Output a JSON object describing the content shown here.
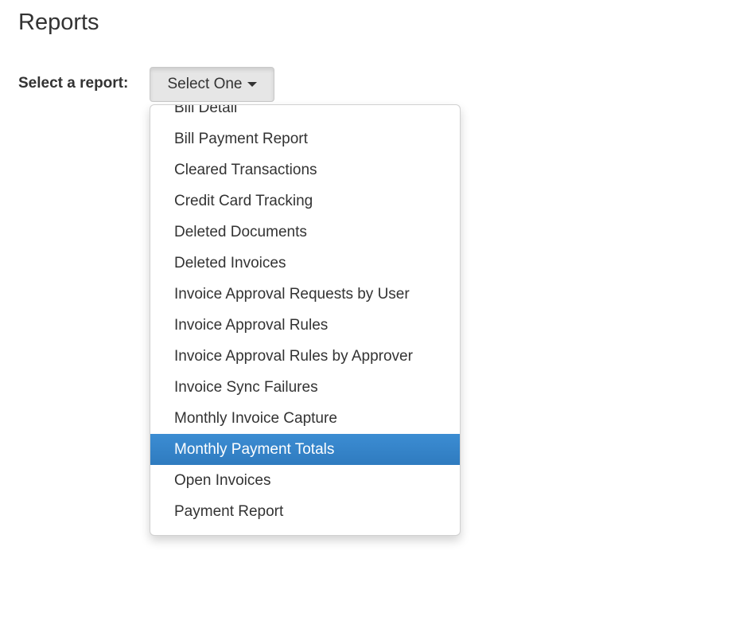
{
  "page": {
    "title": "Reports"
  },
  "report_selector": {
    "label": "Select a report:",
    "button_label": "Select One",
    "caret_icon": "caret-down-icon",
    "active_color": "#337ab7",
    "options": [
      {
        "label": "Bill Detail",
        "active": false
      },
      {
        "label": "Bill Payment Report",
        "active": false
      },
      {
        "label": "Cleared Transactions",
        "active": false
      },
      {
        "label": "Credit Card Tracking",
        "active": false
      },
      {
        "label": "Deleted Documents",
        "active": false
      },
      {
        "label": "Deleted Invoices",
        "active": false
      },
      {
        "label": "Invoice Approval Requests by User",
        "active": false
      },
      {
        "label": "Invoice Approval Rules",
        "active": false
      },
      {
        "label": "Invoice Approval Rules by Approver",
        "active": false
      },
      {
        "label": "Invoice Sync Failures",
        "active": false
      },
      {
        "label": "Monthly Invoice Capture",
        "active": false
      },
      {
        "label": "Monthly Payment Totals",
        "active": true
      },
      {
        "label": "Open Invoices",
        "active": false
      },
      {
        "label": "Payment Report",
        "active": false
      }
    ]
  }
}
